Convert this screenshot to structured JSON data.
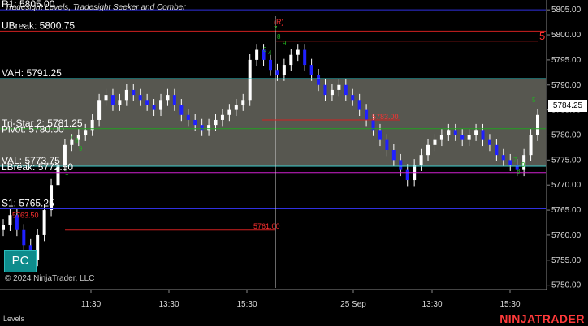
{
  "chart_data": {
    "type": "candlestick",
    "indicator_title": "Tradesight Levels, Tradesight Seeker and Comber",
    "last_price": "5784.25",
    "ylim": [
      5748,
      5806
    ],
    "y_ticks": [
      "5805.00",
      "5800.00",
      "5795.00",
      "5790.00",
      "5785.00",
      "5780.00",
      "5775.00",
      "5770.00",
      "5765.00",
      "5760.00",
      "5755.00",
      "5750.00"
    ],
    "x_ticks": [
      "11:30",
      "13:30",
      "15:30",
      "25 Sep",
      "13:30",
      "15:30"
    ],
    "levels": [
      {
        "label": "R1: 5805.00",
        "price": 5805.0,
        "color": "#3030e0"
      },
      {
        "label": "UBreak: 5800.75",
        "price": 5800.75,
        "color": "#d02020"
      },
      {
        "label": "VAH: 5791.25",
        "price": 5791.25,
        "color": "#40d0d0"
      },
      {
        "label": "Tri-Star 2: 5781.25",
        "price": 5781.25,
        "color": "#20a020"
      },
      {
        "label": "Pivot: 5780.00",
        "price": 5780.0,
        "color": "#3030e0"
      },
      {
        "label": "VAL: 5773.75",
        "price": 5773.75,
        "color": "#40d0d0"
      },
      {
        "label": "LBreak: 5772.50",
        "price": 5772.5,
        "color": "#d020d0"
      },
      {
        "label": "S1: 5765.25",
        "price": 5765.25,
        "color": "#3030e0"
      }
    ],
    "annotations": [
      {
        "text": "5761.00",
        "price": 5761.0
      },
      {
        "text": "5783.00",
        "price": 5783.0
      },
      {
        "text": "5763.50",
        "price": 5763.5
      }
    ],
    "red_marker": "5",
    "r_marker": "(R)",
    "seq_labels": [
      "3",
      "4",
      "7",
      "8",
      "9",
      "1",
      "7",
      "8",
      "9",
      "7",
      "8",
      "9",
      "5"
    ],
    "series_close": [
      5762,
      5764,
      5761,
      5758,
      5755,
      5760,
      5765,
      5770,
      5774,
      5778,
      5779,
      5780,
      5781,
      5783,
      5787,
      5788,
      5786,
      5787,
      5789,
      5788,
      5787,
      5786,
      5785,
      5787,
      5788,
      5786,
      5784,
      5783,
      5782,
      5781,
      5782,
      5783,
      5784,
      5785,
      5786,
      5787,
      5795,
      5797,
      5795,
      5793,
      5792,
      5794,
      5796,
      5797,
      5794,
      5792,
      5790,
      5788,
      5789,
      5790,
      5788,
      5787,
      5785,
      5783,
      5781,
      5779,
      5777,
      5775,
      5773,
      5771,
      5774,
      5776,
      5778,
      5779,
      5780,
      5781,
      5780,
      5779,
      5780,
      5781,
      5779,
      5778,
      5776,
      5775,
      5774,
      5773,
      5776,
      5780,
      5784
    ]
  },
  "ui": {
    "pc_button": "PC",
    "copyright": "© 2024 NinjaTrader, LLC",
    "brand": "NINJATRADER",
    "panel_label": "Levels"
  }
}
